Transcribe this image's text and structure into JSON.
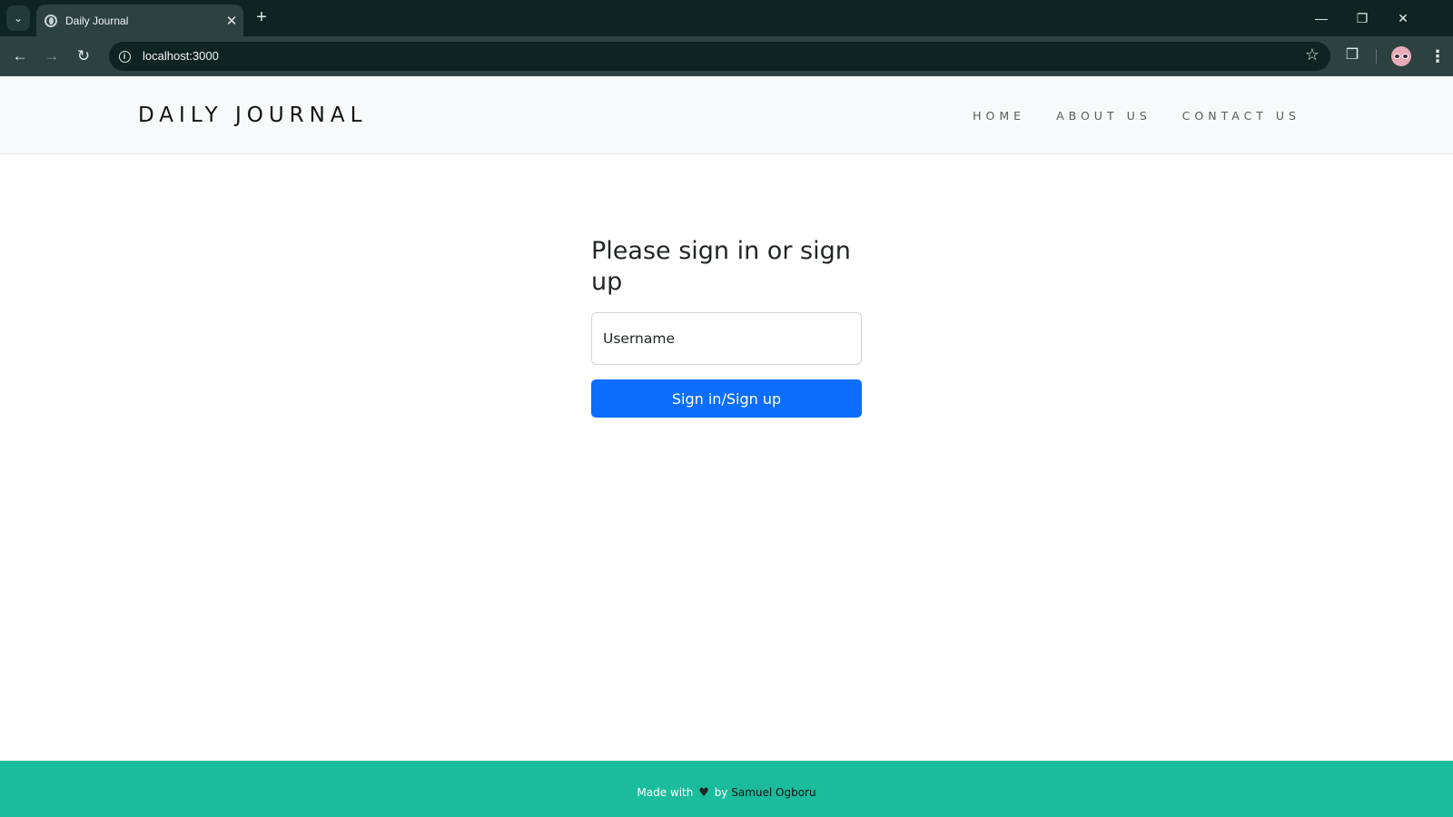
{
  "browser": {
    "tab_title": "Daily Journal",
    "url": "localhost:3000",
    "icons": {
      "tab_menu": "chevron-down-icon",
      "new_tab": "plus-icon",
      "back": "arrow-left-icon",
      "forward": "arrow-right-icon",
      "reload": "reload-icon",
      "site_info": "info-icon",
      "bookmark": "star-icon",
      "extensions": "puzzle-icon",
      "menu": "kebab-icon"
    }
  },
  "header": {
    "brand": "DAILY JOURNAL",
    "nav": [
      {
        "label": "HOME"
      },
      {
        "label": "ABOUT US"
      },
      {
        "label": "CONTACT US"
      }
    ]
  },
  "form": {
    "title": "Please sign in or sign up",
    "username_placeholder": "Username",
    "submit_label": "Sign in/Sign up"
  },
  "footer": {
    "made_with": "Made with",
    "by": "by",
    "author": "Samuel Ogboru"
  },
  "colors": {
    "accent": "#0d6efd",
    "footer": "#1abc9c",
    "header_bg": "#f8f9fa"
  }
}
